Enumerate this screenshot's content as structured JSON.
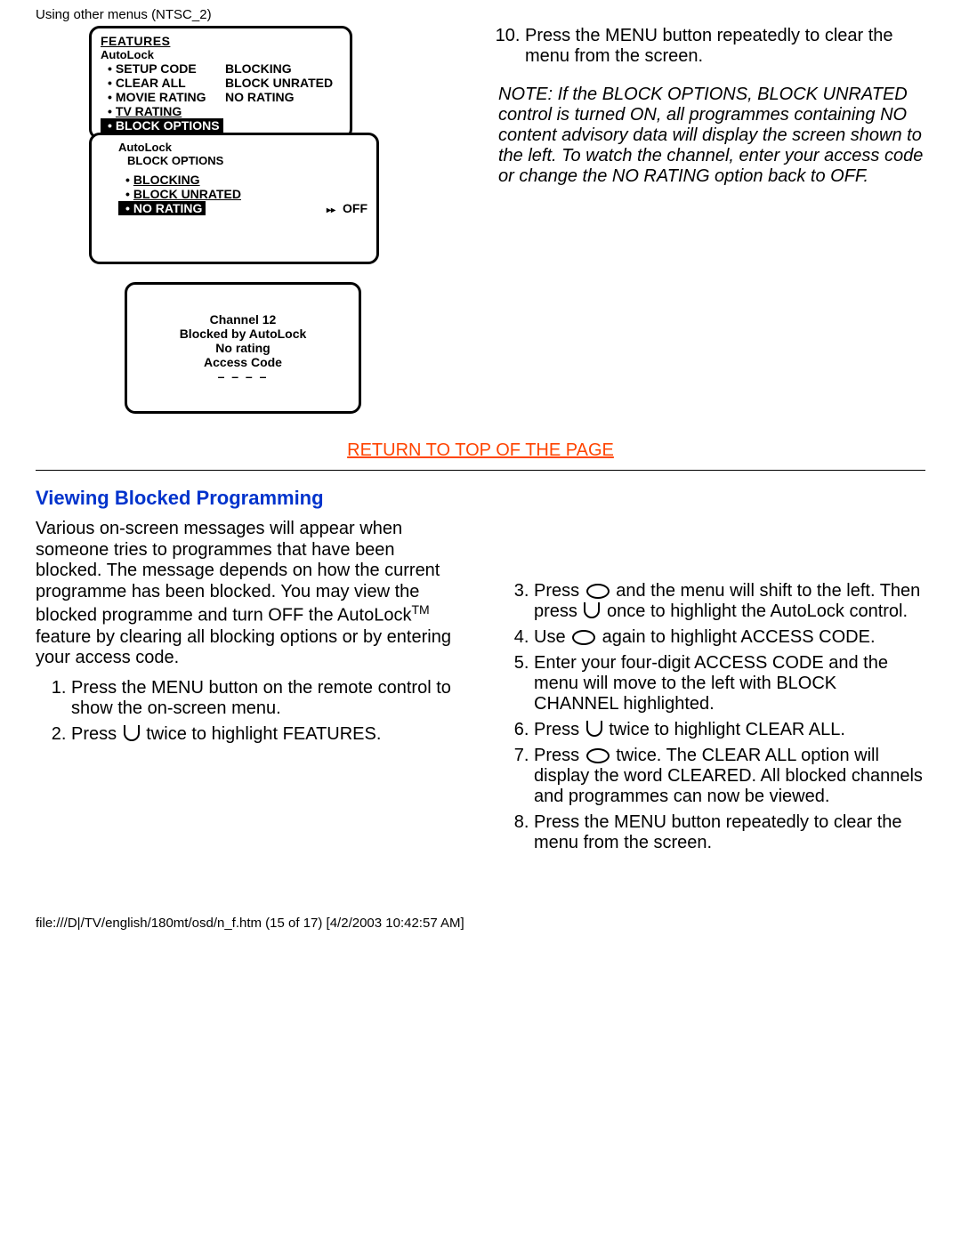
{
  "header": "Using other menus (NTSC_2)",
  "tvbox1": {
    "title": "FEATURES",
    "sub": "AutoLock",
    "rows": [
      {
        "left": "SETUP CODE",
        "right": "BLOCKING"
      },
      {
        "left": "CLEAR ALL",
        "right": "BLOCK UNRATED"
      },
      {
        "left": "MOVIE RATING",
        "right": "NO RATING"
      },
      {
        "left": "TV RATING",
        "right": ""
      }
    ],
    "selected": "BLOCK OPTIONS"
  },
  "tvbox2": {
    "sub": "AutoLock",
    "sub2": "BLOCK OPTIONS",
    "rows": [
      "BLOCKING",
      "BLOCK UNRATED"
    ],
    "selected": "NO RATING",
    "arrow": "▸▸",
    "value": "OFF"
  },
  "tvbox3": {
    "l1": "Channel 12",
    "l2": "Blocked by AutoLock",
    "l3": "No rating",
    "l4": "Access Code",
    "l5": "– – – –"
  },
  "step10": "Press the MENU button repeatedly to clear the menu from the screen.",
  "note": "NOTE: If the BLOCK OPTIONS, BLOCK UNRATED control is turned ON, all programmes containing NO content advisory data will display the screen shown to the left. To watch the channel, enter your access code or change the NO RATING option back to OFF.",
  "return_link": "RETURN TO TOP OF THE PAGE",
  "section_title": "Viewing Blocked Programming",
  "intro_a": "Various on-screen messages will appear when someone tries to programmes that have been blocked. The message depends on how the current programme has been blocked. You may view the blocked programme and turn OFF the AutoLock",
  "intro_tm": "TM",
  "intro_b": " feature by clearing all blocking options or by entering your access code.",
  "left_steps": {
    "s1": "Press the MENU button on the remote control to show the on-screen menu.",
    "s2a": "Press ",
    "s2b": " twice to highlight FEATURES."
  },
  "right_steps": {
    "s3a": "Press ",
    "s3b": " and the menu will shift to the left. Then press ",
    "s3c": " once to highlight the AutoLock control.",
    "s4a": "Use ",
    "s4b": " again to highlight ACCESS CODE.",
    "s5": "Enter your four-digit ACCESS CODE and the menu will move to the left with BLOCK CHANNEL highlighted.",
    "s6a": "Press ",
    "s6b": " twice to highlight CLEAR ALL.",
    "s7a": "Press ",
    "s7b": " twice. The CLEAR ALL option will display the word CLEARED. All blocked channels and programmes can now be viewed.",
    "s8": "Press the MENU button repeatedly to clear the menu from the screen."
  },
  "footer": "file:///D|/TV/english/180mt/osd/n_f.htm (15 of 17) [4/2/2003 10:42:57 AM]"
}
